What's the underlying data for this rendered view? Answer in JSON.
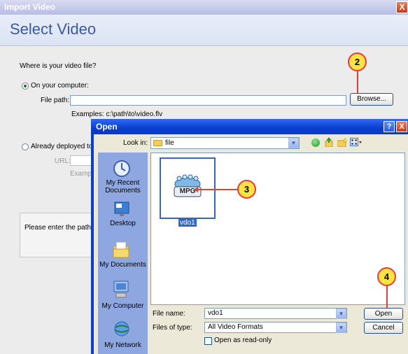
{
  "import_dialog": {
    "title": "Import Video",
    "close_glyph": "X",
    "heading": "Select Video",
    "question": "Where is your video file?",
    "on_computer_label": "On your computer:",
    "file_path_label": "File path:",
    "file_path_value": "",
    "browse_label": "Browse...",
    "examples_text": "Examples:  c:\\path\\to\\video.flv",
    "deployed_label": "Already deployed to a",
    "url_label": "URL:",
    "url_examples_partial": "Exampl",
    "hint_text": "Please enter the path o"
  },
  "open_dialog": {
    "title": "Open",
    "help_glyph": "?",
    "close_glyph": "X",
    "look_in_label": "Look in:",
    "look_in_value": "file",
    "places": [
      {
        "label": "My Recent Documents",
        "icon": "recent-documents-icon"
      },
      {
        "label": "Desktop",
        "icon": "desktop-icon"
      },
      {
        "label": "My Documents",
        "icon": "my-documents-icon"
      },
      {
        "label": "My Computer",
        "icon": "my-computer-icon"
      },
      {
        "label": "My Network",
        "icon": "my-network-icon"
      }
    ],
    "file": {
      "name": "vdo1",
      "badge": "MPG"
    },
    "file_name_label": "File name:",
    "file_name_value": "vdo1",
    "files_of_type_label": "Files of type:",
    "files_of_type_value": "All Video Formats",
    "read_only_label": "Open as read-only",
    "open_label": "Open",
    "cancel_label": "Cancel"
  },
  "callouts": [
    "2",
    "3",
    "4"
  ],
  "colors": {
    "heading_blue": "#3b59a3",
    "xp_titlebar": "#0a3dd1",
    "callout_fill": "#ffe341",
    "callout_stroke": "#e83b3b",
    "selection": "#316ac5"
  }
}
